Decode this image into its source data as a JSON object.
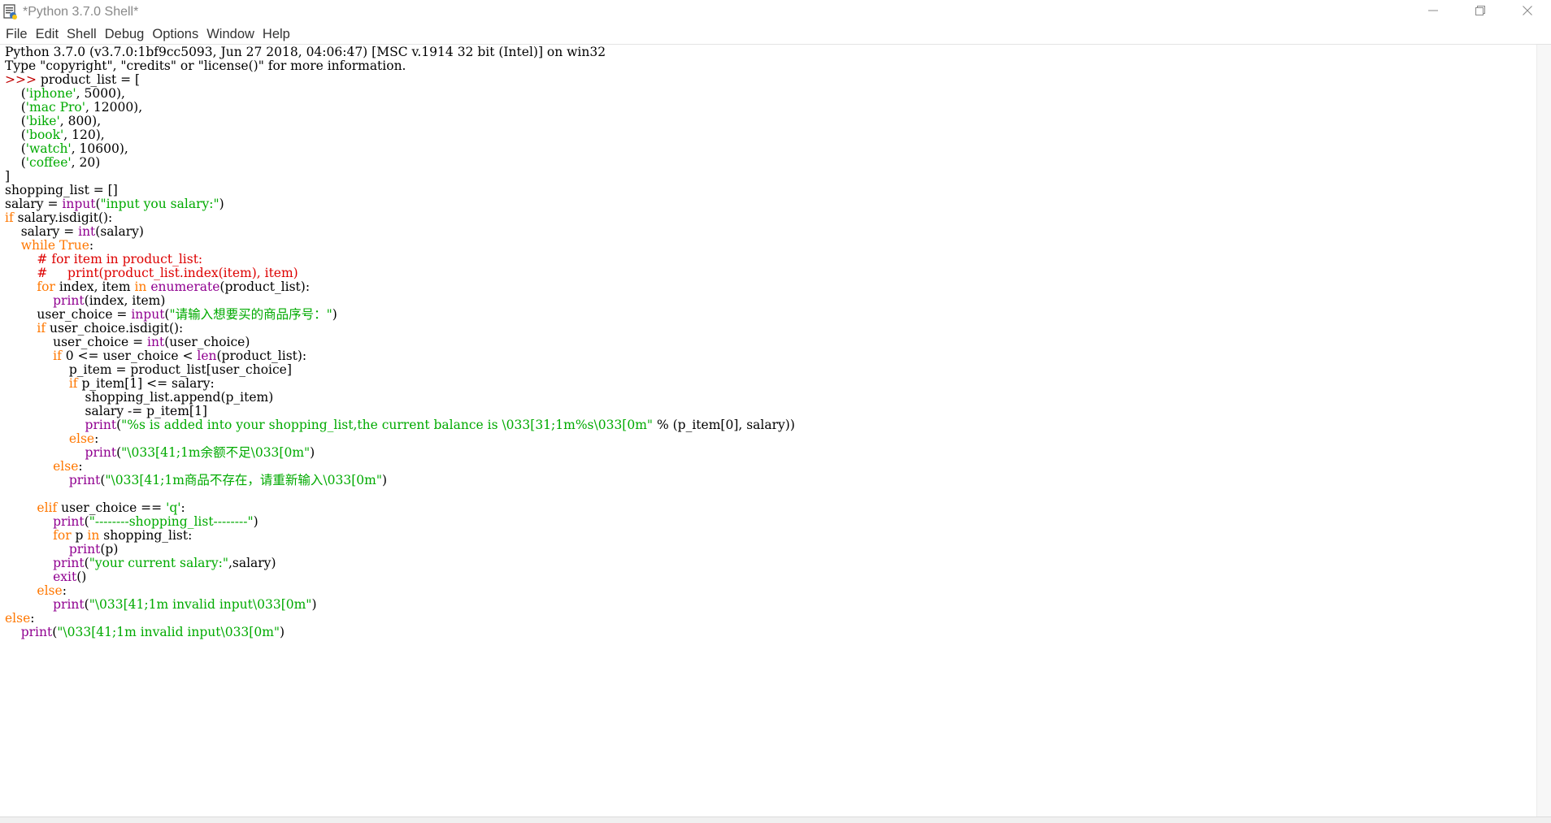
{
  "window": {
    "title": "*Python 3.7.0 Shell*"
  },
  "menu": [
    "File",
    "Edit",
    "Shell",
    "Debug",
    "Options",
    "Window",
    "Help"
  ],
  "icons": {
    "app": "python-idle-icon",
    "minimize": "minimize-icon",
    "restore": "restore-icon",
    "close": "close-icon"
  },
  "colors": {
    "prompt": "#c00000",
    "keyword": "#ff7700",
    "builtin": "#900090",
    "string": "#00aa00",
    "comment": "#dd0000"
  },
  "shell_lines": [
    [
      {
        "t": "Python 3.7.0 (v3.7.0:1bf9cc5093, Jun 27 2018, 04:06:47) [MSC v.1914 32 bit (Intel)] on win32",
        "c": ""
      }
    ],
    [
      {
        "t": "Type \"copyright\", \"credits\" or \"license()\" for more information.",
        "c": ""
      }
    ],
    [
      {
        "t": ">>> ",
        "c": "prompt"
      },
      {
        "t": "product_list = [",
        "c": ""
      }
    ],
    [
      {
        "t": "    (",
        "c": ""
      },
      {
        "t": "'iphone'",
        "c": "str"
      },
      {
        "t": ", 5000),",
        "c": ""
      }
    ],
    [
      {
        "t": "    (",
        "c": ""
      },
      {
        "t": "'mac Pro'",
        "c": "str"
      },
      {
        "t": ", 12000),",
        "c": ""
      }
    ],
    [
      {
        "t": "    (",
        "c": ""
      },
      {
        "t": "'bike'",
        "c": "str"
      },
      {
        "t": ", 800),",
        "c": ""
      }
    ],
    [
      {
        "t": "    (",
        "c": ""
      },
      {
        "t": "'book'",
        "c": "str"
      },
      {
        "t": ", 120),",
        "c": ""
      }
    ],
    [
      {
        "t": "    (",
        "c": ""
      },
      {
        "t": "'watch'",
        "c": "str"
      },
      {
        "t": ", 10600),",
        "c": ""
      }
    ],
    [
      {
        "t": "    (",
        "c": ""
      },
      {
        "t": "'coffee'",
        "c": "str"
      },
      {
        "t": ", 20)",
        "c": ""
      }
    ],
    [
      {
        "t": "]",
        "c": ""
      }
    ],
    [
      {
        "t": "shopping_list = []",
        "c": ""
      }
    ],
    [
      {
        "t": "salary = ",
        "c": ""
      },
      {
        "t": "input",
        "c": "bi"
      },
      {
        "t": "(",
        "c": ""
      },
      {
        "t": "\"input you salary:\"",
        "c": "str"
      },
      {
        "t": ")",
        "c": ""
      }
    ],
    [
      {
        "t": "if",
        "c": "kw"
      },
      {
        "t": " salary.isdigit():",
        "c": ""
      }
    ],
    [
      {
        "t": "    salary = ",
        "c": ""
      },
      {
        "t": "int",
        "c": "bi"
      },
      {
        "t": "(salary)",
        "c": ""
      }
    ],
    [
      {
        "t": "    ",
        "c": ""
      },
      {
        "t": "while",
        "c": "kw"
      },
      {
        "t": " ",
        "c": ""
      },
      {
        "t": "True",
        "c": "kw"
      },
      {
        "t": ":",
        "c": ""
      }
    ],
    [
      {
        "t": "        ",
        "c": ""
      },
      {
        "t": "# for item in product_list:",
        "c": "com"
      }
    ],
    [
      {
        "t": "        ",
        "c": ""
      },
      {
        "t": "#     print(product_list.index(item), item)",
        "c": "com"
      }
    ],
    [
      {
        "t": "        ",
        "c": ""
      },
      {
        "t": "for",
        "c": "kw"
      },
      {
        "t": " index, item ",
        "c": ""
      },
      {
        "t": "in",
        "c": "kw"
      },
      {
        "t": " ",
        "c": ""
      },
      {
        "t": "enumerate",
        "c": "bi"
      },
      {
        "t": "(product_list):",
        "c": ""
      }
    ],
    [
      {
        "t": "            ",
        "c": ""
      },
      {
        "t": "print",
        "c": "bi"
      },
      {
        "t": "(index, item)",
        "c": ""
      }
    ],
    [
      {
        "t": "        user_choice = ",
        "c": ""
      },
      {
        "t": "input",
        "c": "bi"
      },
      {
        "t": "(",
        "c": ""
      },
      {
        "t": "\"请输入想要买的商品序号：\"",
        "c": "str"
      },
      {
        "t": ")",
        "c": ""
      }
    ],
    [
      {
        "t": "        ",
        "c": ""
      },
      {
        "t": "if",
        "c": "kw"
      },
      {
        "t": " user_choice.isdigit():",
        "c": ""
      }
    ],
    [
      {
        "t": "            user_choice = ",
        "c": ""
      },
      {
        "t": "int",
        "c": "bi"
      },
      {
        "t": "(user_choice)",
        "c": ""
      }
    ],
    [
      {
        "t": "            ",
        "c": ""
      },
      {
        "t": "if",
        "c": "kw"
      },
      {
        "t": " 0 <= user_choice < ",
        "c": ""
      },
      {
        "t": "len",
        "c": "bi"
      },
      {
        "t": "(product_list):",
        "c": ""
      }
    ],
    [
      {
        "t": "                p_item = product_list[user_choice]",
        "c": ""
      }
    ],
    [
      {
        "t": "                ",
        "c": ""
      },
      {
        "t": "if",
        "c": "kw"
      },
      {
        "t": " p_item[1] <= salary:",
        "c": ""
      }
    ],
    [
      {
        "t": "                    shopping_list.append(p_item)",
        "c": ""
      }
    ],
    [
      {
        "t": "                    salary -= p_item[1]",
        "c": ""
      }
    ],
    [
      {
        "t": "                    ",
        "c": ""
      },
      {
        "t": "print",
        "c": "bi"
      },
      {
        "t": "(",
        "c": ""
      },
      {
        "t": "\"%s is added into your shopping_list,the current balance is \\033[31;1m%s\\033[0m\"",
        "c": "str"
      },
      {
        "t": " % (p_item[0], salary))",
        "c": ""
      }
    ],
    [
      {
        "t": "                ",
        "c": ""
      },
      {
        "t": "else",
        "c": "kw"
      },
      {
        "t": ":",
        "c": ""
      }
    ],
    [
      {
        "t": "                    ",
        "c": ""
      },
      {
        "t": "print",
        "c": "bi"
      },
      {
        "t": "(",
        "c": ""
      },
      {
        "t": "\"\\033[41;1m余额不足\\033[0m\"",
        "c": "str"
      },
      {
        "t": ")",
        "c": ""
      }
    ],
    [
      {
        "t": "            ",
        "c": ""
      },
      {
        "t": "else",
        "c": "kw"
      },
      {
        "t": ":",
        "c": ""
      }
    ],
    [
      {
        "t": "                ",
        "c": ""
      },
      {
        "t": "print",
        "c": "bi"
      },
      {
        "t": "(",
        "c": ""
      },
      {
        "t": "\"\\033[41;1m商品不存在，请重新输入\\033[0m\"",
        "c": "str"
      },
      {
        "t": ")",
        "c": ""
      }
    ],
    [
      {
        "t": "",
        "c": ""
      }
    ],
    [
      {
        "t": "        ",
        "c": ""
      },
      {
        "t": "elif",
        "c": "kw"
      },
      {
        "t": " user_choice == ",
        "c": ""
      },
      {
        "t": "'q'",
        "c": "str"
      },
      {
        "t": ":",
        "c": ""
      }
    ],
    [
      {
        "t": "            ",
        "c": ""
      },
      {
        "t": "print",
        "c": "bi"
      },
      {
        "t": "(",
        "c": ""
      },
      {
        "t": "\"--------shopping_list--------\"",
        "c": "str"
      },
      {
        "t": ")",
        "c": ""
      }
    ],
    [
      {
        "t": "            ",
        "c": ""
      },
      {
        "t": "for",
        "c": "kw"
      },
      {
        "t": " p ",
        "c": ""
      },
      {
        "t": "in",
        "c": "kw"
      },
      {
        "t": " shopping_list:",
        "c": ""
      }
    ],
    [
      {
        "t": "                ",
        "c": ""
      },
      {
        "t": "print",
        "c": "bi"
      },
      {
        "t": "(p)",
        "c": ""
      }
    ],
    [
      {
        "t": "            ",
        "c": ""
      },
      {
        "t": "print",
        "c": "bi"
      },
      {
        "t": "(",
        "c": ""
      },
      {
        "t": "\"your current salary:\"",
        "c": "str"
      },
      {
        "t": ",salary)",
        "c": ""
      }
    ],
    [
      {
        "t": "            ",
        "c": ""
      },
      {
        "t": "exit",
        "c": "bi"
      },
      {
        "t": "()",
        "c": ""
      }
    ],
    [
      {
        "t": "        ",
        "c": ""
      },
      {
        "t": "else",
        "c": "kw"
      },
      {
        "t": ":",
        "c": ""
      }
    ],
    [
      {
        "t": "            ",
        "c": ""
      },
      {
        "t": "print",
        "c": "bi"
      },
      {
        "t": "(",
        "c": ""
      },
      {
        "t": "\"\\033[41;1m invalid input\\033[0m\"",
        "c": "str"
      },
      {
        "t": ")",
        "c": ""
      }
    ],
    [
      {
        "t": "else",
        "c": "kw"
      },
      {
        "t": ":",
        "c": ""
      }
    ],
    [
      {
        "t": "    ",
        "c": ""
      },
      {
        "t": "print",
        "c": "bi"
      },
      {
        "t": "(",
        "c": ""
      },
      {
        "t": "\"\\033[41;1m invalid input\\033[0m\"",
        "c": "str"
      },
      {
        "t": ")",
        "c": ""
      }
    ]
  ]
}
